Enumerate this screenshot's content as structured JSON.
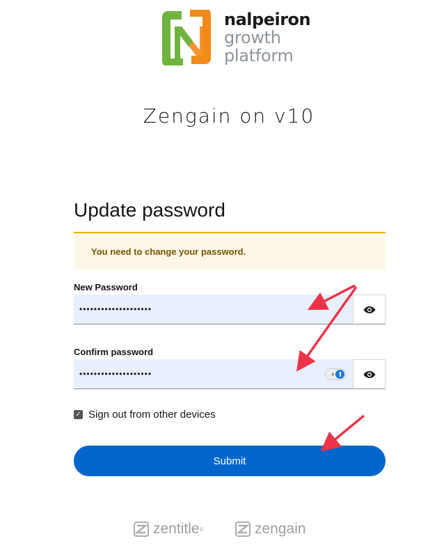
{
  "logo": {
    "line1": "nalpeiron",
    "line2": "growth",
    "line3": "platform"
  },
  "realm_title": "Zengain on v10",
  "form": {
    "title": "Update password",
    "alert": "You need to change your password.",
    "new_password": {
      "label": "New Password",
      "value": "••••••••••••••••••••"
    },
    "confirm_password": {
      "label": "Confirm password",
      "value": "••••••••••••••••••••"
    },
    "sign_out": {
      "label": "Sign out from other devices",
      "checked": true
    },
    "submit_label": "Submit"
  },
  "footer": {
    "brand1": "zentitle",
    "brand1_sup": "II",
    "brand2": "zengain"
  },
  "colors": {
    "primary": "#0066cc",
    "alert_bg": "#fdf7e7",
    "alert_border": "#f0ab00",
    "annotation": "#ee3348"
  },
  "icons": [
    "nalpeiron-logo-icon",
    "eye-icon",
    "password-manager-icon",
    "checkbox-checked-icon",
    "zentitle-logo-icon",
    "zengain-logo-icon"
  ]
}
